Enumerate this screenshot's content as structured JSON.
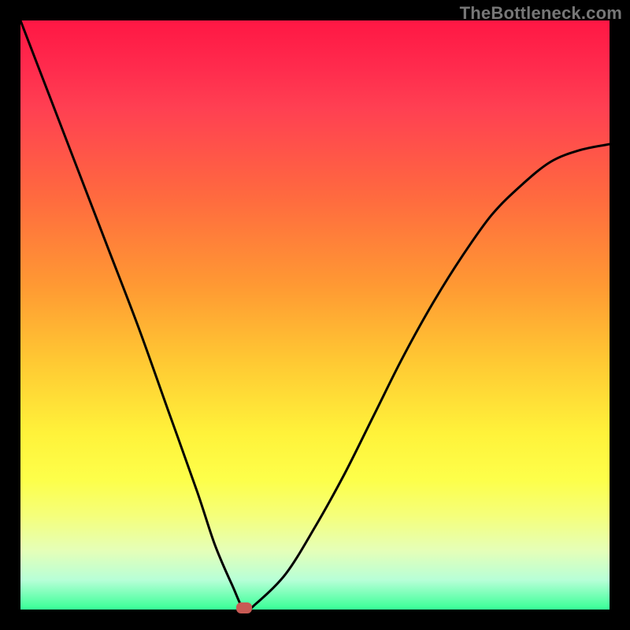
{
  "watermark": "TheBottleneck.com",
  "marker": {
    "x_pct": 38,
    "y_pct": 0
  },
  "chart_data": {
    "type": "line",
    "title": "",
    "xlabel": "",
    "ylabel": "",
    "xlim": [
      0,
      100
    ],
    "ylim": [
      0,
      100
    ],
    "grid": false,
    "legend": false,
    "series": [
      {
        "name": "bottleneck-curve",
        "x": [
          0,
          5,
          10,
          15,
          20,
          25,
          30,
          33,
          36,
          38,
          40,
          45,
          50,
          55,
          60,
          65,
          70,
          75,
          80,
          85,
          90,
          95,
          100
        ],
        "y": [
          100,
          87,
          74,
          61,
          48,
          34,
          20,
          11,
          4,
          0,
          1,
          6,
          14,
          23,
          33,
          43,
          52,
          60,
          67,
          72,
          76,
          78,
          79
        ]
      }
    ],
    "annotations": [
      {
        "type": "marker",
        "x": 38,
        "y": 0,
        "color": "#c85a54",
        "shape": "rounded-rect"
      }
    ],
    "background_gradient": {
      "direction": "vertical",
      "stops": [
        {
          "pct": 0,
          "color": "#ff1744"
        },
        {
          "pct": 30,
          "color": "#ff6a3f"
        },
        {
          "pct": 58,
          "color": "#ffc933"
        },
        {
          "pct": 78,
          "color": "#fdff4a"
        },
        {
          "pct": 95,
          "color": "#b7ffd7"
        },
        {
          "pct": 100,
          "color": "#37ff96"
        }
      ]
    }
  }
}
